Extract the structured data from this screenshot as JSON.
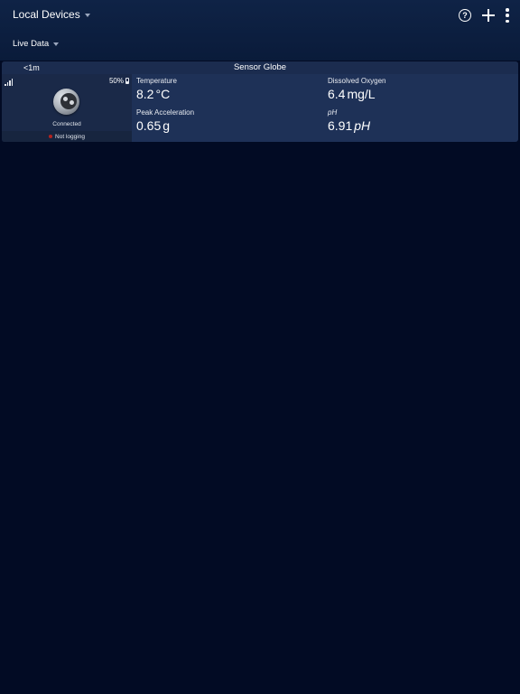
{
  "header": {
    "title": "Local Devices",
    "view": "Live Data",
    "actions": {
      "help_icon": "question-circle",
      "add_icon": "plus",
      "menu_icon": "vertical-ellipsis",
      "help_glyph": "?"
    }
  },
  "device": {
    "last_update": "<1m",
    "name": "Sensor Globe",
    "battery": "50%",
    "battery_level": 0.5,
    "signal_bars": 4,
    "status": "Connected",
    "logging": "Not logging",
    "logging_color": "#b3231f",
    "readings": [
      {
        "label": "Temperature",
        "value": "8.2",
        "unit": "°C"
      },
      {
        "label": "Dissolved Oxygen",
        "value": "6.4",
        "unit": "mg/L"
      },
      {
        "label": "Peak Acceleration",
        "value": "0.65",
        "unit": "g"
      },
      {
        "label": "pH",
        "value": "6.91",
        "unit": "pH"
      }
    ]
  },
  "colors": {
    "background": "#020b24",
    "header": "#0f2346",
    "card": "#1e3157",
    "card_left_panel": "#1a2948"
  }
}
